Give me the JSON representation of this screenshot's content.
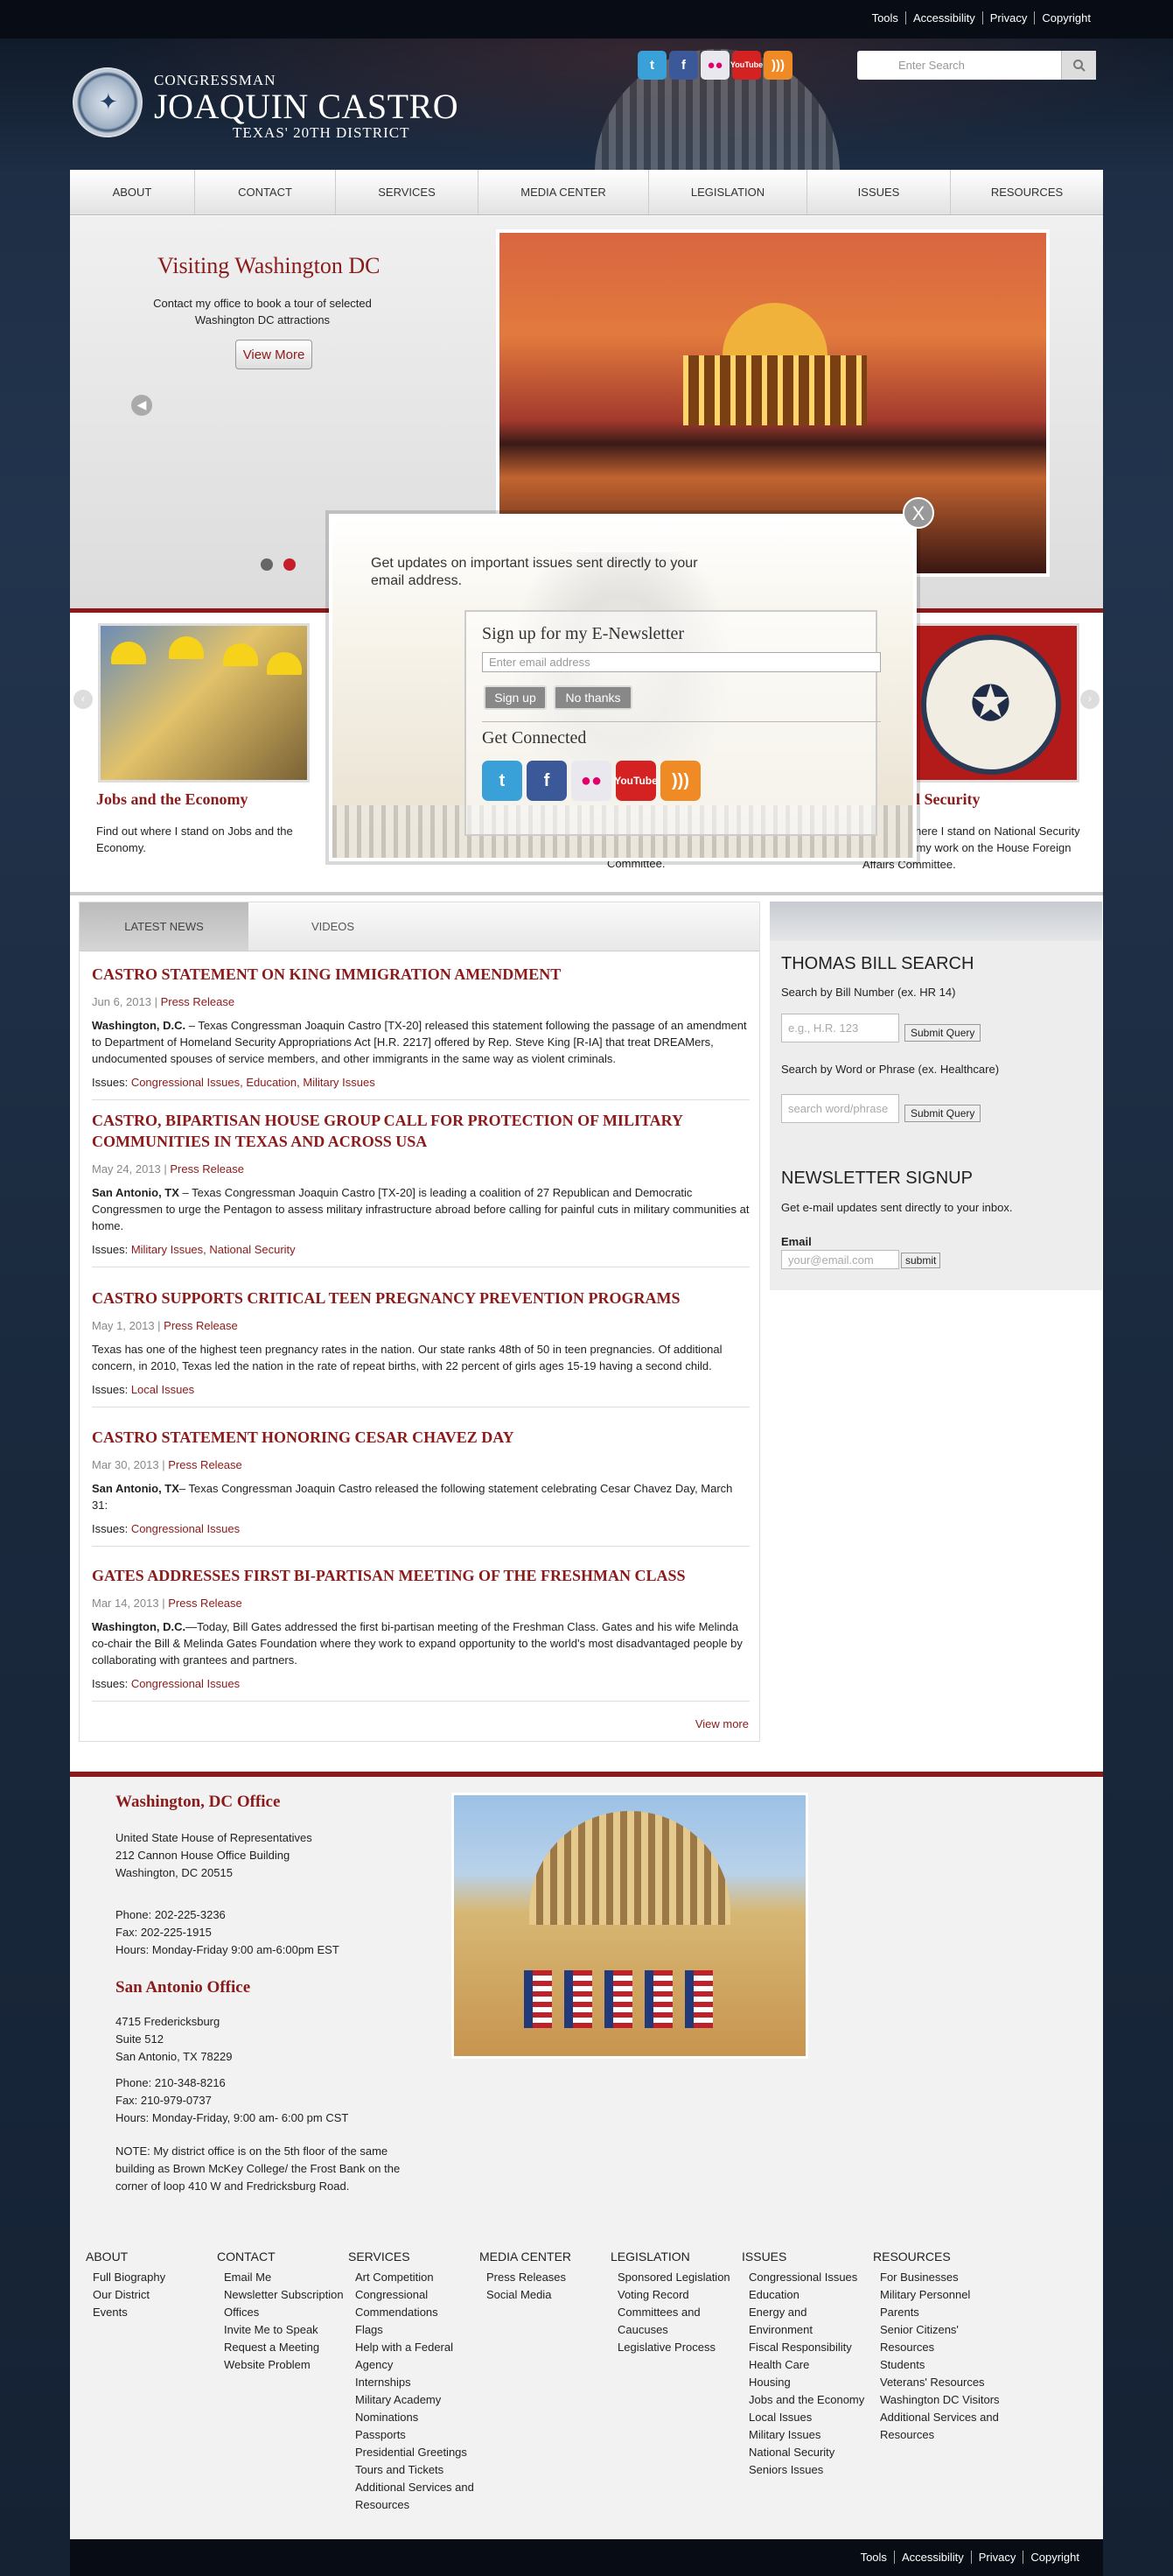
{
  "toplinks": [
    "Tools",
    "Accessibility",
    "Privacy",
    "Copyright"
  ],
  "brand": {
    "line1": "CONGRESSMAN",
    "line2": "JOAQUIN CASTRO",
    "line3": "TEXAS' 20TH DISTRICT"
  },
  "search": {
    "placeholder": "Enter Search"
  },
  "nav": [
    "ABOUT",
    "CONTACT",
    "SERVICES",
    "MEDIA CENTER",
    "LEGISLATION",
    "ISSUES",
    "RESOURCES"
  ],
  "hero": {
    "title": "Visiting Washington DC",
    "text": "Contact my office to book a tour of selected Washington DC attractions",
    "button": "View More"
  },
  "cards": [
    {
      "title": "Jobs and the Economy",
      "text": "Find out where I stand on Jobs and the Economy."
    },
    {
      "title": "National Security",
      "text": "Find out where I stand on National Security and about my work on the House Foreign Affairs Committee."
    }
  ],
  "card_fragment": "Committee.",
  "modal": {
    "intro": "Get updates on important issues sent directly to your email address.",
    "heading": "Sign up for my E-Newsletter",
    "placeholder": "Enter email address",
    "signup": "Sign up",
    "nothanks": "No thanks",
    "connected": "Get Connected",
    "close": "X"
  },
  "tabs": [
    "LATEST NEWS",
    "VIDEOS"
  ],
  "news": [
    {
      "title": "Castro Statement on King Immigration Amendment",
      "date": "Jun 6, 2013",
      "type": "Press Release",
      "lead": "Washington, D.C.",
      "body": " – Texas Congressman Joaquin Castro [TX-20] released this statement following the passage of an amendment to Department of Homeland Security Appropriations Act [H.R. 2217] offered by Rep. Steve King [R-IA] that treat DREAMers, undocumented spouses of service members, and other immigrants in the same way as violent criminals.",
      "issues": "Congressional Issues, Education, Military Issues"
    },
    {
      "title": "Castro, Bipartisan House Group Call for Protection of Military Communities in Texas and Across USA",
      "date": "May 24, 2013",
      "type": "Press Release",
      "lead": "San Antonio, TX",
      "body": " – Texas Congressman Joaquin Castro [TX-20] is leading a coalition of 27 Republican and Democratic Congressmen to urge the Pentagon to assess military infrastructure abroad before calling for painful cuts in military communities at home.",
      "issues": "Military Issues, National Security"
    },
    {
      "title": "Castro Supports Critical Teen Pregnancy Prevention Programs",
      "date": "May 1, 2013",
      "type": "Press Release",
      "lead": "",
      "body": "Texas has one of the highest teen pregnancy rates in the nation. Our state ranks 48th of 50 in teen pregnancies.  Of additional concern, in 2010, Texas led the nation in the rate of repeat births, with 22 percent of girls ages 15-19 having a second child.",
      "issues": "Local Issues"
    },
    {
      "title": "Castro Statement Honoring Cesar Chavez Day",
      "date": "Mar 30, 2013",
      "type": "Press Release",
      "lead": "San Antonio, TX",
      "body": "– Texas Congressman Joaquin Castro released the following statement celebrating Cesar Chavez Day, March 31:",
      "issues": "Congressional Issues"
    },
    {
      "title": "Gates Addresses First Bi-Partisan Meeting of the Freshman Class",
      "date": "Mar 14, 2013",
      "type": "Press Release",
      "lead": "Washington, D.C.",
      "body": "—Today, Bill Gates addressed the first bi-partisan meeting of the Freshman Class. Gates and his wife Melinda co-chair the Bill & Melinda Gates Foundation where they work to expand opportunity to the world's most disadvantaged people by collaborating with grantees and partners.",
      "issues": "Congressional Issues"
    }
  ],
  "issues_label": "Issues:",
  "viewmore": "View more",
  "thomas": {
    "title": "THOMAS BILL SEARCH",
    "num_label": "Search by Bill Number (ex. HR 14)",
    "num_placeholder": "e.g., H.R. 123",
    "submit": "Submit Query",
    "word_label": "Search by Word or Phrase (ex. Healthcare)",
    "word_placeholder": "search word/phrase"
  },
  "newsletter": {
    "title": "NEWSLETTER SIGNUP",
    "text": "Get e-mail updates sent directly to your inbox.",
    "email_label": "Email",
    "placeholder": "your@email.com",
    "submit": "submit"
  },
  "offices": {
    "dc_title": "Washington, DC Office",
    "dc_lines": [
      "United State House of Representatives",
      "212 Cannon House Office Building",
      "Washington, DC 20515"
    ],
    "dc_phone": [
      "Phone: 202-225-3236",
      "Fax: 202-225-1915",
      "Hours: Monday-Friday 9:00 am-6:00pm EST"
    ],
    "sa_title": "San Antonio Office",
    "sa_lines": [
      "4715 Fredericksburg",
      "Suite 512",
      "San Antonio, TX 78229"
    ],
    "sa_phone": [
      "Phone: 210-348-8216",
      "Fax: 210-979-0737",
      "Hours: Monday-Friday, 9:00 am- 6:00 pm CST"
    ],
    "note": "NOTE: My district office is on the 5th floor of the same building as Brown McKey College/ the Frost Bank on the corner of loop 410 W and Fredricksburg Road."
  },
  "footer_cols": [
    {
      "title": "ABOUT",
      "items": [
        "Full Biography",
        "Our District",
        "Events"
      ]
    },
    {
      "title": "CONTACT",
      "items": [
        "Email Me",
        "Newsletter Subscription",
        "Offices",
        "Invite Me to Speak",
        "Request a Meeting",
        "Website Problem"
      ]
    },
    {
      "title": "SERVICES",
      "items": [
        "Art Competition",
        "Congressional Commendations",
        "Flags",
        "Help with a Federal Agency",
        "Internships",
        "Military Academy Nominations",
        "Passports",
        "Presidential Greetings",
        "Tours and Tickets",
        "Additional Services and Resources"
      ]
    },
    {
      "title": "MEDIA CENTER",
      "items": [
        "Press Releases",
        "Social Media"
      ]
    },
    {
      "title": "LEGISLATION",
      "items": [
        "Sponsored Legislation",
        "Voting Record",
        "Committees and Caucuses",
        "Legislative Process"
      ]
    },
    {
      "title": "ISSUES",
      "items": [
        "Congressional Issues",
        "Education",
        "Energy and Environment",
        "Fiscal Responsibility",
        "Health Care",
        "Housing",
        "Jobs and the Economy",
        "Local Issues",
        "Military Issues",
        "National Security",
        "Seniors Issues"
      ]
    },
    {
      "title": "RESOURCES",
      "items": [
        "For Businesses",
        "Military Personnel",
        "Parents",
        "Senior Citizens' Resources",
        "Students",
        "Veterans' Resources",
        "Washington DC Visitors",
        "Additional Services and Resources"
      ]
    }
  ],
  "social_icons": [
    "twitter-icon",
    "facebook-icon",
    "flickr-icon",
    "youtube-icon",
    "rss-icon"
  ],
  "social_glyphs": {
    "twitter": "t",
    "facebook": "f",
    "flickr": "●●",
    "youtube_top": "You",
    "youtube_bottom": "Tube",
    "rss": ")))"
  },
  "carousel_arrows": {
    "left": "‹",
    "right": "›",
    "prev": "◀"
  },
  "colors": {
    "accent": "#8b1a1a",
    "navy": "#1c2a3e"
  }
}
